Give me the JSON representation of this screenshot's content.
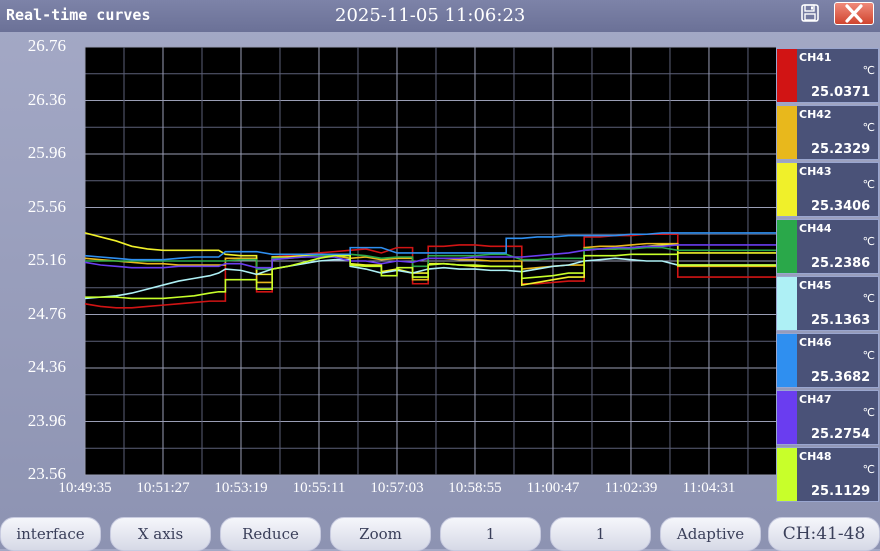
{
  "window": {
    "title": "Real-time curves",
    "datetime": "2025-11-05  11:06:23",
    "save_icon": "floppy-disk-icon",
    "close_icon": "close-icon",
    "close_color": "#d9503a"
  },
  "chart_data": {
    "type": "line",
    "ylim": [
      23.56,
      26.76
    ],
    "yticks": [
      "26.76",
      "26.36",
      "25.96",
      "25.56",
      "25.16",
      "24.76",
      "24.36",
      "23.96",
      "23.56"
    ],
    "xticks": [
      "10:49:35",
      "10:51:27",
      "10:53:19",
      "10:55:11",
      "10:57:03",
      "10:58:55",
      "11:00:47",
      "11:02:39",
      "11:04:31"
    ],
    "x_range_seconds": [
      0,
      1120
    ],
    "grid": true,
    "background": "#000000",
    "x": [
      0,
      28,
      56,
      84,
      112,
      140,
      168,
      196,
      224,
      240,
      252,
      280,
      308,
      336,
      364,
      392,
      420,
      448,
      476,
      504,
      532,
      560,
      588,
      616,
      644,
      672,
      700,
      728,
      756,
      784,
      812,
      840,
      868,
      896,
      924,
      952,
      980,
      1008,
      1036,
      1064,
      1092,
      1120
    ],
    "series": [
      {
        "name": "CH41",
        "color": "#d11414",
        "values": [
          24.84,
          24.82,
          24.81,
          24.81,
          24.82,
          24.83,
          24.84,
          24.85,
          24.86,
          24.86,
          25.18,
          25.18,
          24.93,
          25.19,
          25.2,
          25.21,
          25.22,
          25.23,
          25.24,
          25.25,
          25.22,
          25.26,
          24.99,
          25.27,
          25.27,
          25.28,
          25.28,
          25.27,
          25.27,
          24.99,
          24.99,
          25.0,
          25.01,
          25.34,
          25.34,
          25.35,
          25.35,
          25.36,
          25.36,
          25.04,
          25.04,
          25.04
        ]
      },
      {
        "name": "CH42",
        "color": "#e8b81c",
        "values": [
          25.18,
          25.17,
          25.16,
          25.15,
          25.14,
          25.14,
          25.13,
          25.13,
          25.13,
          25.13,
          25.18,
          25.18,
          25.0,
          25.18,
          25.19,
          25.19,
          25.2,
          25.2,
          25.18,
          25.19,
          25.17,
          25.18,
          25.02,
          25.18,
          25.18,
          25.17,
          25.17,
          25.16,
          25.16,
          25.1,
          25.11,
          25.12,
          25.13,
          25.26,
          25.27,
          25.27,
          25.28,
          25.29,
          25.29,
          25.12,
          25.12,
          25.12
        ]
      },
      {
        "name": "CH43",
        "color": "#f0f02a",
        "values": [
          25.37,
          25.34,
          25.31,
          25.27,
          25.25,
          25.24,
          25.24,
          25.24,
          25.24,
          25.24,
          25.21,
          25.2,
          25.06,
          25.19,
          25.19,
          25.2,
          25.2,
          25.2,
          25.14,
          25.13,
          25.08,
          25.1,
          25.07,
          25.14,
          25.14,
          25.13,
          25.12,
          25.12,
          25.12,
          24.98,
          25.0,
          25.02,
          25.04,
          25.24,
          25.25,
          25.25,
          25.26,
          25.27,
          25.28,
          25.22,
          25.22,
          25.22
        ]
      },
      {
        "name": "CH44",
        "color": "#2aa84a",
        "values": [
          25.16,
          25.16,
          25.16,
          25.16,
          25.16,
          25.16,
          25.16,
          25.16,
          25.16,
          25.16,
          25.16,
          25.17,
          25.1,
          25.18,
          25.18,
          25.19,
          25.2,
          25.21,
          25.21,
          25.2,
          25.18,
          25.19,
          25.12,
          25.2,
          25.2,
          25.2,
          25.2,
          25.21,
          25.21,
          25.17,
          25.17,
          25.18,
          25.18,
          25.25,
          25.25,
          25.25,
          25.25,
          25.26,
          25.26,
          25.24,
          25.24,
          25.24
        ]
      },
      {
        "name": "CH45",
        "color": "#aef0f5",
        "values": [
          24.88,
          24.89,
          24.9,
          24.92,
          24.95,
          24.98,
          25.01,
          25.03,
          25.05,
          25.07,
          25.1,
          25.09,
          25.06,
          25.1,
          25.12,
          25.14,
          25.16,
          25.17,
          25.12,
          25.1,
          25.07,
          25.09,
          25.07,
          25.1,
          25.11,
          25.1,
          25.1,
          25.09,
          25.09,
          25.08,
          25.1,
          25.12,
          25.13,
          25.16,
          25.17,
          25.18,
          25.17,
          25.16,
          25.16,
          25.13,
          25.13,
          25.13
        ]
      },
      {
        "name": "CH46",
        "color": "#2f8ff0",
        "values": [
          25.2,
          25.19,
          25.18,
          25.17,
          25.17,
          25.17,
          25.18,
          25.19,
          25.19,
          25.19,
          25.23,
          25.23,
          25.23,
          25.21,
          25.21,
          25.21,
          25.21,
          25.21,
          25.26,
          25.26,
          25.26,
          25.22,
          25.22,
          25.22,
          25.22,
          25.22,
          25.22,
          25.22,
          25.33,
          25.33,
          25.34,
          25.34,
          25.35,
          25.35,
          25.35,
          25.35,
          25.36,
          25.36,
          25.37,
          25.37,
          25.37,
          25.37
        ]
      },
      {
        "name": "CH47",
        "color": "#6a3df0",
        "values": [
          25.15,
          25.13,
          25.12,
          25.11,
          25.11,
          25.11,
          25.12,
          25.12,
          25.12,
          25.12,
          25.14,
          25.14,
          25.11,
          25.17,
          25.18,
          25.19,
          25.19,
          25.19,
          25.16,
          25.16,
          25.14,
          25.16,
          25.15,
          25.18,
          25.18,
          25.18,
          25.19,
          25.19,
          25.19,
          25.19,
          25.2,
          25.21,
          25.22,
          25.24,
          25.25,
          25.26,
          25.26,
          25.27,
          25.27,
          25.28,
          25.28,
          25.28
        ]
      },
      {
        "name": "CH48",
        "color": "#c8ff2a",
        "values": [
          24.89,
          24.89,
          24.89,
          24.88,
          24.88,
          24.88,
          24.89,
          24.9,
          24.92,
          24.93,
          25.02,
          25.02,
          24.95,
          25.1,
          25.12,
          25.15,
          25.18,
          25.2,
          25.13,
          25.12,
          25.05,
          25.11,
          25.04,
          25.13,
          25.14,
          25.13,
          25.13,
          25.12,
          25.12,
          25.03,
          25.04,
          25.05,
          25.07,
          25.2,
          25.2,
          25.2,
          25.21,
          25.21,
          25.21,
          25.13,
          25.13,
          25.13
        ]
      }
    ]
  },
  "legend": {
    "unit": "℃",
    "channels": [
      {
        "name": "CH41",
        "value": "25.0371",
        "color": "#d11414"
      },
      {
        "name": "CH42",
        "value": "25.2329",
        "color": "#e8b81c"
      },
      {
        "name": "CH43",
        "value": "25.3406",
        "color": "#f0f02a"
      },
      {
        "name": "CH44",
        "value": "25.2386",
        "color": "#2aa84a"
      },
      {
        "name": "CH45",
        "value": "25.1363",
        "color": "#aef0f5"
      },
      {
        "name": "CH46",
        "value": "25.3682",
        "color": "#2f8ff0"
      },
      {
        "name": "CH47",
        "value": "25.2754",
        "color": "#6a3df0"
      },
      {
        "name": "CH48",
        "value": "25.1129",
        "color": "#c8ff2a"
      }
    ]
  },
  "toolbar": {
    "buttons": [
      "interface",
      "X axis",
      "Reduce",
      "Zoom",
      "1",
      "1",
      "Adaptive",
      "CH:41-48"
    ]
  }
}
